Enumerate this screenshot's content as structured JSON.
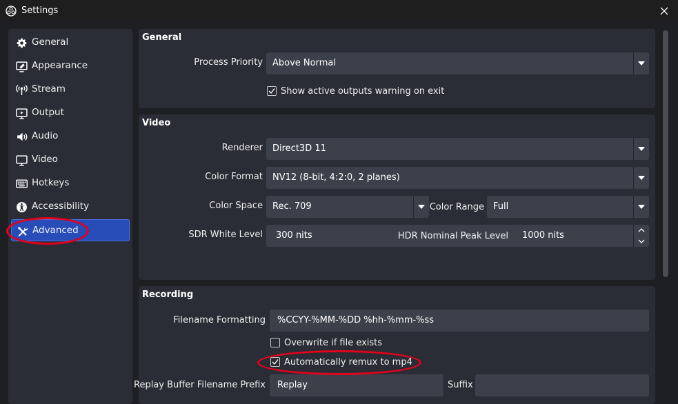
{
  "window": {
    "title": "Settings",
    "app_icon": "obs-logo-icon",
    "close_icon": "close-icon"
  },
  "sidebar": {
    "items": [
      {
        "label": "General",
        "icon": "gear-icon"
      },
      {
        "label": "Appearance",
        "icon": "appearance-icon"
      },
      {
        "label": "Stream",
        "icon": "broadcast-icon"
      },
      {
        "label": "Output",
        "icon": "output-monitor-icon"
      },
      {
        "label": "Audio",
        "icon": "speaker-icon"
      },
      {
        "label": "Video",
        "icon": "monitor-icon"
      },
      {
        "label": "Hotkeys",
        "icon": "keyboard-icon"
      },
      {
        "label": "Accessibility",
        "icon": "accessibility-icon"
      },
      {
        "label": "Advanced",
        "icon": "tools-icon",
        "active": true
      }
    ]
  },
  "general": {
    "title": "General",
    "process_priority_label": "Process Priority",
    "process_priority_value": "Above Normal",
    "show_warning_label": "Show active outputs warning on exit",
    "show_warning_checked": true
  },
  "video": {
    "title": "Video",
    "renderer_label": "Renderer",
    "renderer_value": "Direct3D 11",
    "color_format_label": "Color Format",
    "color_format_value": "NV12 (8-bit, 4:2:0, 2 planes)",
    "color_space_label": "Color Space",
    "color_space_value": "Rec. 709",
    "color_range_label": "Color Range",
    "color_range_value": "Full",
    "sdr_label": "SDR White Level",
    "sdr_value": "300 nits",
    "hdr_label": "HDR Nominal Peak Level",
    "hdr_value": "1000 nits"
  },
  "recording": {
    "title": "Recording",
    "filename_label": "Filename Formatting",
    "filename_value": "%CCYY-%MM-%DD %hh-%mm-%ss",
    "overwrite_label": "Overwrite if file exists",
    "overwrite_checked": false,
    "remux_label": "Automatically remux to mp4",
    "remux_checked": true,
    "replay_prefix_label": "Replay Buffer Filename Prefix",
    "replay_prefix_value": "Replay",
    "suffix_label": "Suffix",
    "suffix_value": ""
  },
  "colors": {
    "accent": "#284cb8",
    "panel": "#2b2d36",
    "input": "#3c404b",
    "background": "#1e1f23",
    "annotation": "#e2001a"
  }
}
